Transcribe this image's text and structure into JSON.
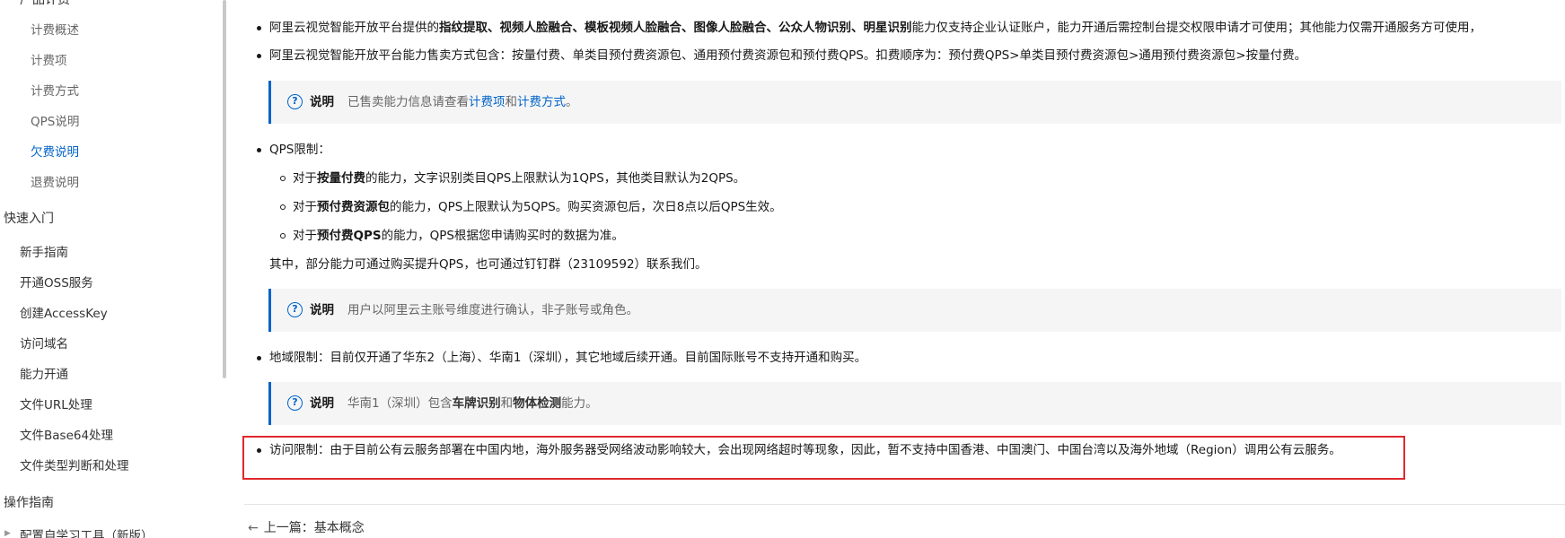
{
  "sidebar": {
    "top_clipped": "产品计费",
    "billing_items": [
      {
        "label": "计费概述",
        "active": false
      },
      {
        "label": "计费项",
        "active": false
      },
      {
        "label": "计费方式",
        "active": false
      },
      {
        "label": "QPS说明",
        "active": false
      },
      {
        "label": "欠费说明",
        "active": true
      },
      {
        "label": "退费说明",
        "active": false
      }
    ],
    "quickstart_title": "快速入门",
    "quickstart_items": [
      "新手指南",
      "开通OSS服务",
      "创建AccessKey",
      "访问域名",
      "能力开通",
      "文件URL处理",
      "文件Base64处理",
      "文件类型判断和处理"
    ],
    "guide_title": "操作指南",
    "guide_first_item": "配置自学习工具（新版）"
  },
  "content": {
    "bullet1": {
      "prefix": "阿里云视觉智能开放平台提供的",
      "bold": "指纹提取、视频人脸融合、模板视频人脸融合、图像人脸融合、公众人物识别、明星识别",
      "suffix": "能力仅支持企业认证账户，能力开通后需控制台提交权限申请才可使用；其他能力仅需开通服务方可使用，"
    },
    "bullet2": "阿里云视觉智能开放平台能力售卖方式包含：按量付费、单类目预付费资源包、通用预付费资源包和预付费QPS。扣费顺序为：预付费QPS>单类目预付费资源包>通用预付费资源包>按量付费。",
    "note1": {
      "label": "说明",
      "prefix": "已售卖能力信息请查看",
      "link1": "计费项",
      "mid": "和",
      "link2": "计费方式",
      "suffix": "。"
    },
    "qps_title": "QPS限制：",
    "qps_sub1": {
      "prefix": "对于",
      "bold": "按量付费",
      "suffix": "的能力，文字识别类目QPS上限默认为1QPS，其他类目默认为2QPS。"
    },
    "qps_sub2": {
      "prefix": "对于",
      "bold": "预付费资源包",
      "suffix": "的能力，QPS上限默认为5QPS。购买资源包后，次日8点以后QPS生效。"
    },
    "qps_sub3": {
      "prefix": "对于",
      "bold": "预付费QPS",
      "suffix": "的能力，QPS根据您申请购买时的数据为准。"
    },
    "qps_extra": "其中，部分能力可通过购买提升QPS，也可通过钉钉群（23109592）联系我们。",
    "note2": {
      "label": "说明",
      "text": "用户以阿里云主账号维度进行确认，非子账号或角色。"
    },
    "region_limit": "地域限制：目前仅开通了华东2（上海）、华南1（深圳），其它地域后续开通。目前国际账号不支持开通和购买。",
    "note3": {
      "label": "说明",
      "prefix": "华南1（深圳）包含",
      "bold1": "车牌识别",
      "mid": "和",
      "bold2": "物体检测",
      "suffix": "能力。"
    },
    "access_limit": "访问限制：由于目前公有云服务部署在中国内地，海外服务器受网络波动影响较大，会出现网络超时等现象，因此，暂不支持中国香港、中国澳门、中国台湾以及海外地域（Region）调用公有云服务。",
    "prev_link": "上一篇：基本概念"
  },
  "colors": {
    "accent": "#0064c8",
    "highlight": "#e0282d",
    "note_bg": "#f5f5f6"
  }
}
